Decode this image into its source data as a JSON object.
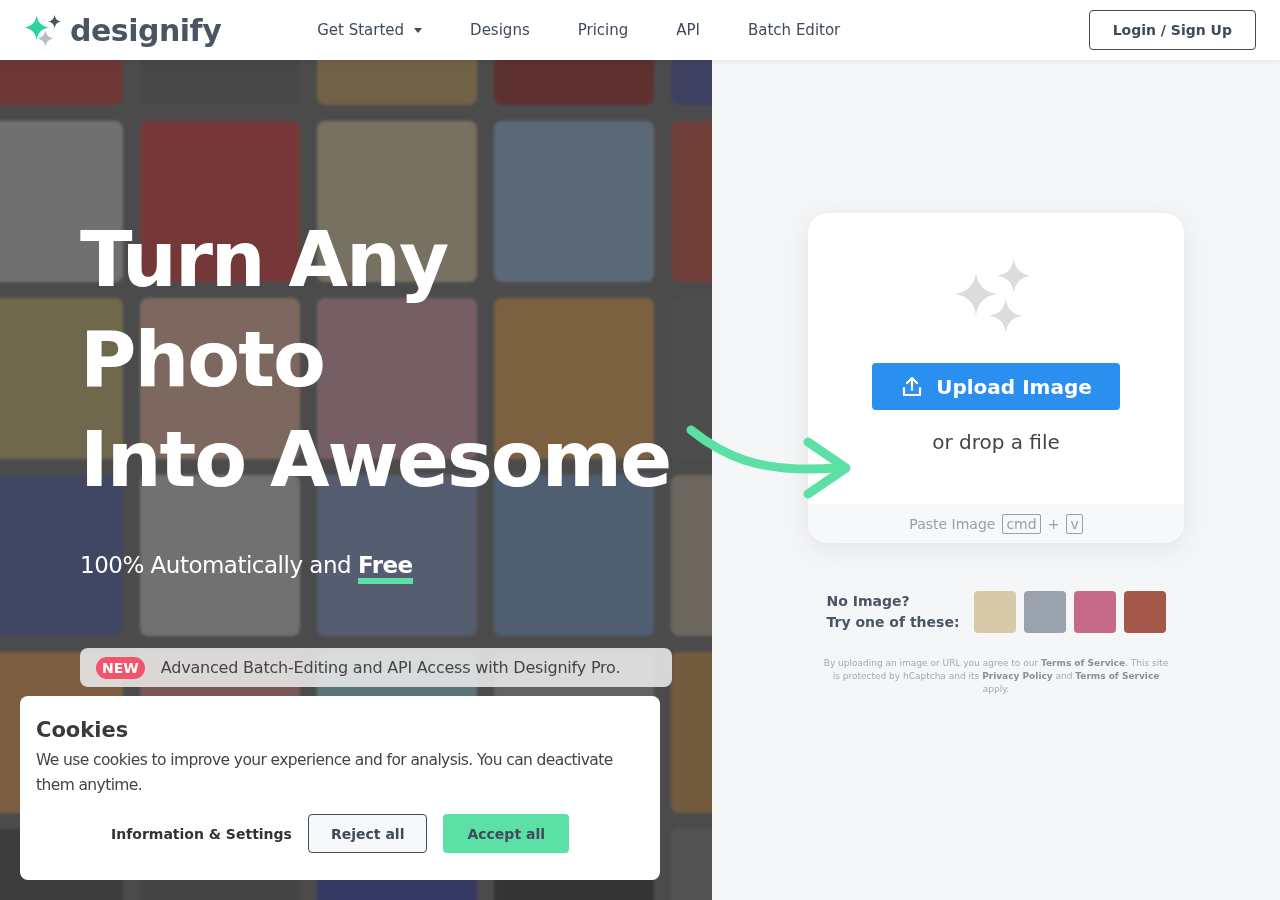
{
  "header": {
    "logo": "designify",
    "nav": [
      {
        "label": "Get Started",
        "dropdown": true
      },
      {
        "label": "Designs",
        "dropdown": false
      },
      {
        "label": "Pricing",
        "dropdown": false
      },
      {
        "label": "API",
        "dropdown": false
      },
      {
        "label": "Batch Editor",
        "dropdown": false
      }
    ],
    "login": "Login / Sign Up"
  },
  "hero": {
    "headline_lines": [
      "Turn Any",
      "Photo",
      "Into Awesome"
    ],
    "subtitle": "100% Automatically and **Free**",
    "banner": {
      "badge": "NEW",
      "text": "Advanced Batch-Editing and API Access with Designify Pro."
    }
  },
  "upload": {
    "button": "Upload Image",
    "drop_hint": "or drop a file",
    "paste_label": "Paste Image",
    "keys": [
      "cmd",
      "v"
    ],
    "key_separator": "+"
  },
  "samples": {
    "prompt_lines": [
      "No Image?",
      "Try one of these:"
    ]
  },
  "legal": "By uploading an image or URL you agree to our **Terms of Service**. This site is protected by hCaptcha and its **Privacy Policy** and **Terms of Service** apply.",
  "cookies": {
    "title": "Cookies",
    "text": "We use cookies to improve your experience and for analysis. You can deactivate them anytime.",
    "buttons": [
      {
        "label": "Information & Settings",
        "kind": "link"
      },
      {
        "label": "Reject all",
        "kind": "secondary"
      },
      {
        "label": "Accept all",
        "kind": "primary"
      }
    ]
  }
}
